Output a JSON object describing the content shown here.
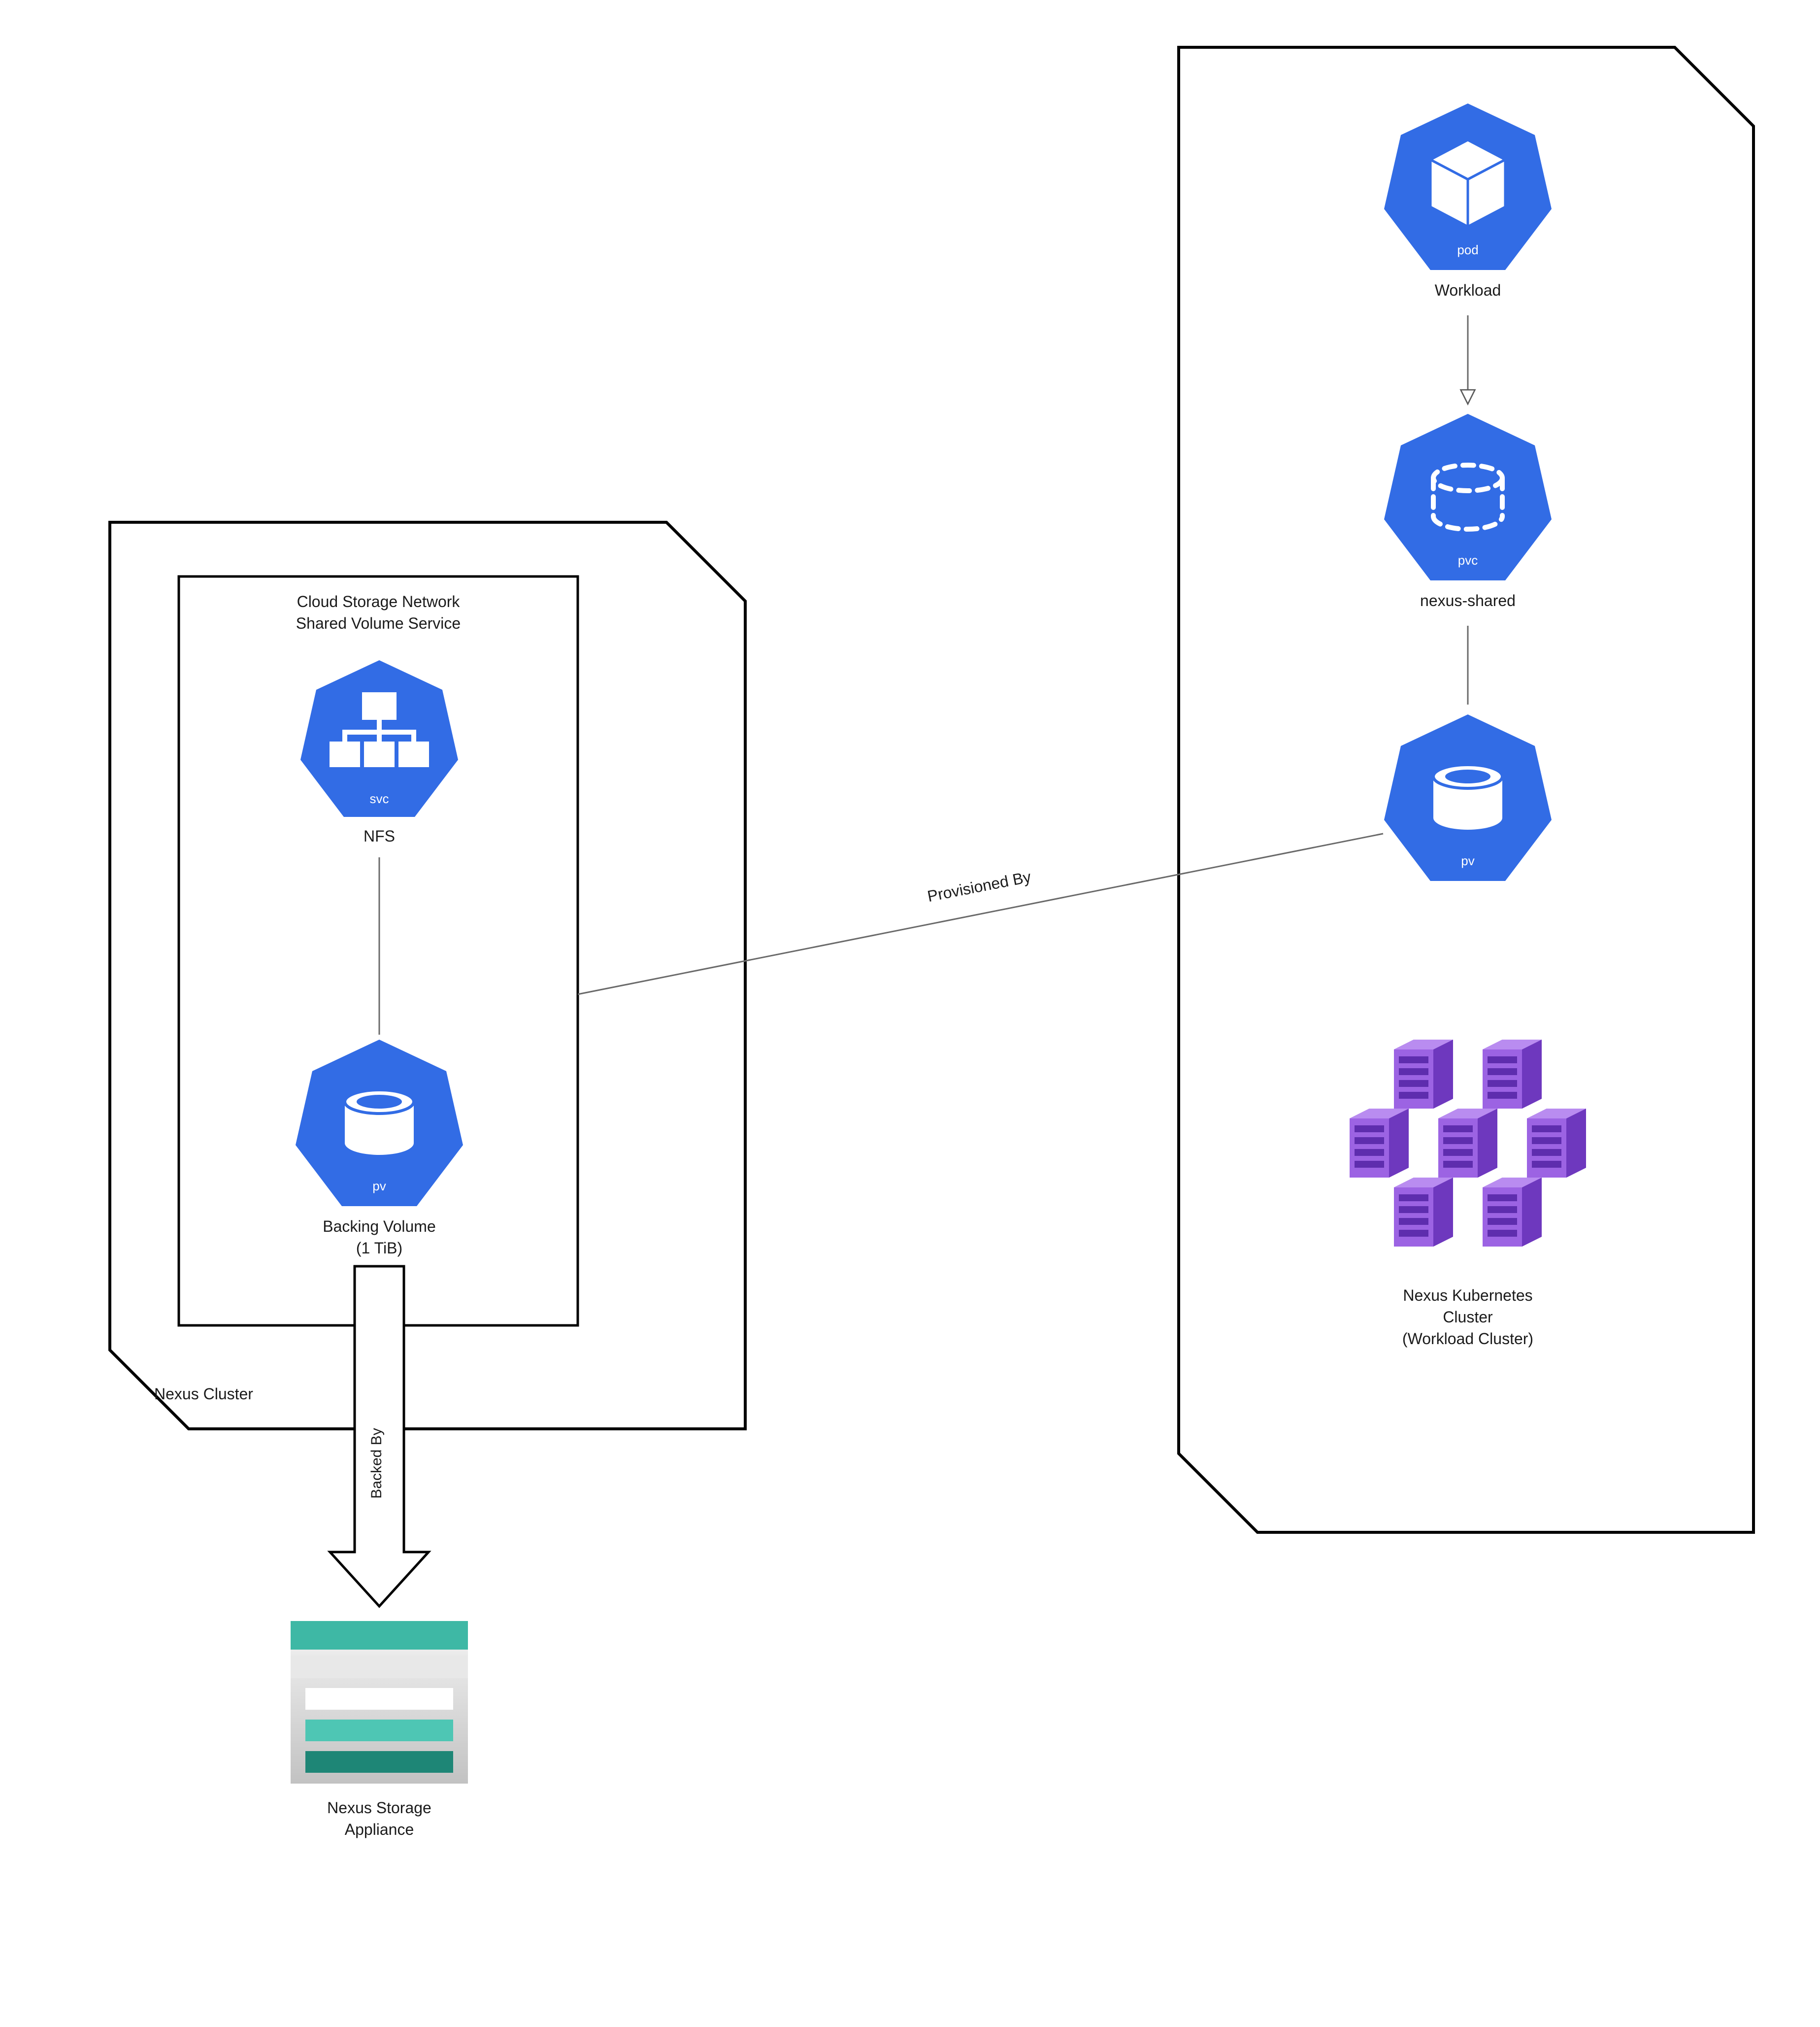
{
  "left": {
    "container_label": "Nexus Cluster",
    "service_title_1": "Cloud Storage Network",
    "service_title_2": "Shared Volume Service",
    "svc_badge": "svc",
    "svc_label": "NFS",
    "pv_badge": "pv",
    "pv_label_1": "Backing Volume",
    "pv_label_2": "(1 TiB)",
    "backed_by": "Backed By",
    "appliance_1": "Nexus Storage",
    "appliance_2": "Appliance"
  },
  "right": {
    "pod_badge": "pod",
    "pod_label": "Workload",
    "pvc_badge": "pvc",
    "pvc_label": "nexus-shared",
    "pv_badge": "pv",
    "cluster_label_1": "Nexus Kubernetes",
    "cluster_label_2": "Cluster",
    "cluster_label_3": "(Workload Cluster)"
  },
  "edges": {
    "provisioned_by": "Provisioned By"
  },
  "colors": {
    "k8s_blue": "#326CE5",
    "teal": "#3EB8A5",
    "teal_mid": "#4EC6B4",
    "teal_dark": "#1E8676",
    "grey_light": "#E8E8E8",
    "purple": "#8C4FD6",
    "purple_edge": "#5E2DAE"
  }
}
